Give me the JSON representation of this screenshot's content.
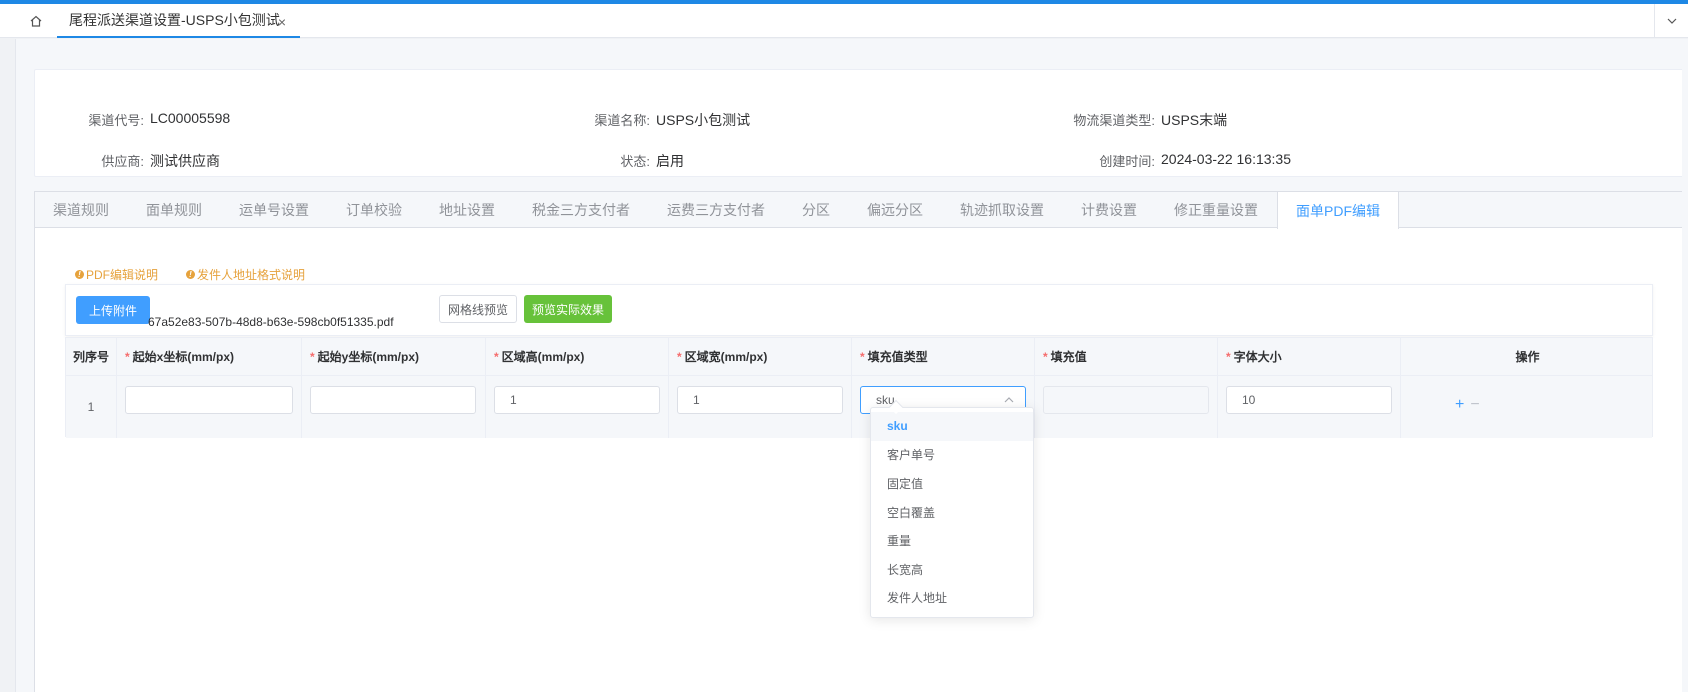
{
  "tabs": {
    "home_icon": "home-icon",
    "active_tab_label": "尾程派送渠道设置-USPS小包测试",
    "close_glyph": "×"
  },
  "info": {
    "row1": [
      {
        "label": "渠道代号:",
        "value": "LC00005598"
      },
      {
        "label": "渠道名称:",
        "value": "USPS小包测试"
      },
      {
        "label": "物流渠道类型:",
        "value": "USPS末端"
      }
    ],
    "row2": [
      {
        "label": "供应商:",
        "value": "测试供应商"
      },
      {
        "label": "状态:",
        "value": "启用"
      },
      {
        "label": "创建时间:",
        "value": "2024-03-22 16:13:35"
      }
    ]
  },
  "subtabs": [
    "渠道规则",
    "面单规则",
    "运单号设置",
    "订单校验",
    "地址设置",
    "税金三方支付者",
    "运费三方支付者",
    "分区",
    "偏远分区",
    "轨迹抓取设置",
    "计费设置",
    "修正重量设置",
    "面单PDF编辑"
  ],
  "active_subtab_index": 12,
  "links": {
    "pdf_help": "PDF编辑说明",
    "sender_help": "发件人地址格式说明"
  },
  "toolbar": {
    "upload_label": "上传附件",
    "file_name": "67a52e83-507b-48d8-b63e-598cb0f51335.pdf",
    "grid_preview_label": "网格线预览",
    "preview_effect_label": "预览实际效果"
  },
  "table": {
    "headers": {
      "index": "列序号",
      "start_x": "起始x坐标(mm/px)",
      "start_y": "起始y坐标(mm/px)",
      "area_h": "区域高(mm/px)",
      "area_w": "区域宽(mm/px)",
      "fill_type": "填充值类型",
      "fill_value": "填充值",
      "font_size": "字体大小",
      "ops": "操作"
    },
    "required_mark": "*",
    "row": {
      "index": "1",
      "start_x": "",
      "start_y": "",
      "area_h": "1",
      "area_w": "1",
      "fill_type": "sku",
      "fill_value": "",
      "font_size": "10",
      "add_glyph": "+",
      "remove_glyph": "−"
    }
  },
  "dropdown": {
    "options": [
      "sku",
      "客户单号",
      "固定值",
      "空白覆盖",
      "重量",
      "长宽高",
      "发件人地址"
    ],
    "selected": "sku"
  },
  "colors": {
    "primary": "#409eff",
    "success": "#67c23a",
    "warning": "#e6a23c",
    "danger": "#f56c6c",
    "top_accent": "#1e88e5"
  }
}
